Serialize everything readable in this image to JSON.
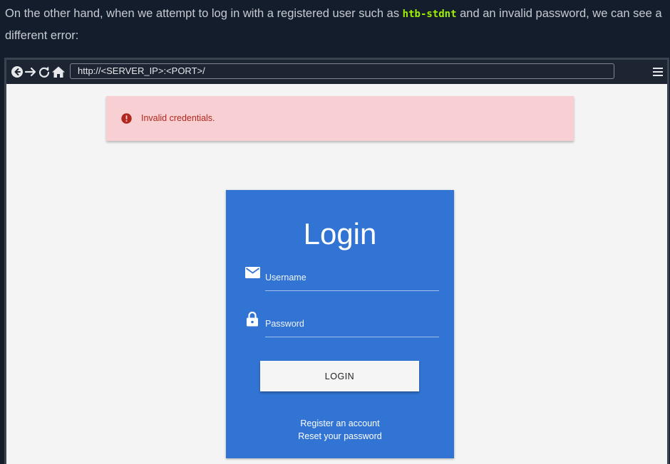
{
  "prose": {
    "before_code": "On the other hand, when we attempt to log in with a registered user such as ",
    "code": "htb-stdnt",
    "after_code": " and an invalid password, we can see a different error:"
  },
  "browser": {
    "url": "http://<SERVER_IP>:<PORT>/",
    "icons": [
      "back-icon",
      "forward-icon",
      "reload-icon",
      "home-icon",
      "menu-icon"
    ]
  },
  "alert": {
    "message": "Invalid credentials.",
    "icon": "error-circle-icon"
  },
  "login": {
    "title": "Login",
    "username_label": "Username",
    "password_label": "Password",
    "button_label": "LOGIN",
    "register_link": "Register an account",
    "reset_link": "Reset your password"
  },
  "colors": {
    "page_bg": "#141d2b",
    "code_accent": "#9fef00",
    "card_blue": "#3274d3",
    "alert_bg": "#f8d0d3",
    "alert_text": "#b3261e"
  }
}
